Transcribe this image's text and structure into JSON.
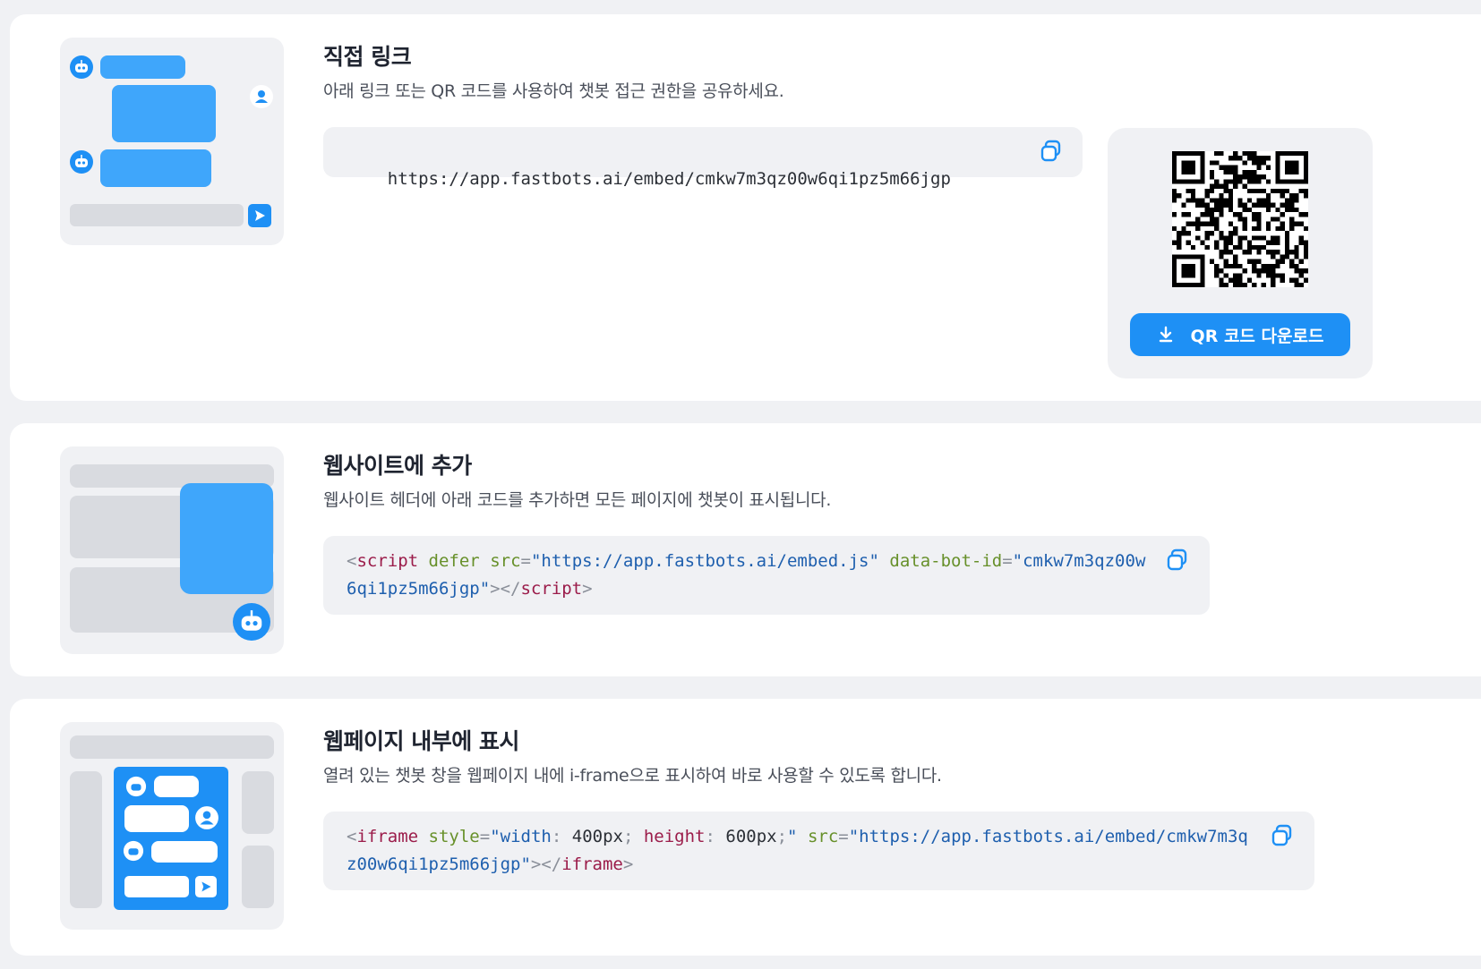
{
  "direct_link": {
    "title": "직접 링크",
    "description": "아래 링크 또는 QR 코드를 사용하여 챗봇 접근 권한을 공유하세요.",
    "url": "https://app.fastbots.ai/embed/cmkw7m3qz00w6qi1pz5m66jgp",
    "qr_download_label": "QR 코드 다운로드"
  },
  "website_embed": {
    "title": "웹사이트에 추가",
    "description": "웹사이트 헤더에 아래 코드를 추가하면 모든 페이지에 챗봇이 표시됩니다.",
    "code": {
      "open_lt": "<",
      "tag": "script",
      "attr1": "defer",
      "attr2": "src",
      "eq": "=",
      "val2": "\"https://app.fastbots.ai/embed.js\"",
      "attr3": "data-bot-id",
      "val3": "\"cmkw7m3qz00w6qi1pz5m66jgp\"",
      "close_gt": "></",
      "end_gt": ">"
    }
  },
  "iframe_embed": {
    "title": "웹페이지 내부에 표시",
    "description": "열려 있는 챗봇 창을 웹페이지 내에 i-frame으로 표시하여 바로 사용할 수 있도록 합니다.",
    "code": {
      "open_lt": "<",
      "tag": "iframe",
      "attr1": "style",
      "eq": "=",
      "q": "\"",
      "css_p1": "width",
      "colon": ": ",
      "css_v1": "400px",
      "semi": "; ",
      "css_p2": "height",
      "css_v2": "600px",
      "semi2": ";",
      "attr2": "src",
      "val2": "\"https://app.fastbots.ai/embed/cmkw7m3qz00w6qi1pz5m66jgp\"",
      "close_gt": "></",
      "end_gt": ">"
    }
  },
  "icons": {
    "copy": "copy-icon",
    "download": "download-icon",
    "bot": "bot-icon",
    "user": "user-icon",
    "send": "send-icon"
  },
  "colors": {
    "accent": "#1e90f5",
    "bubble": "#3fa6fb",
    "panel": "#f0f1f4",
    "tag": "#9b1c4a",
    "attr": "#67902a",
    "string": "#1e5fae"
  }
}
